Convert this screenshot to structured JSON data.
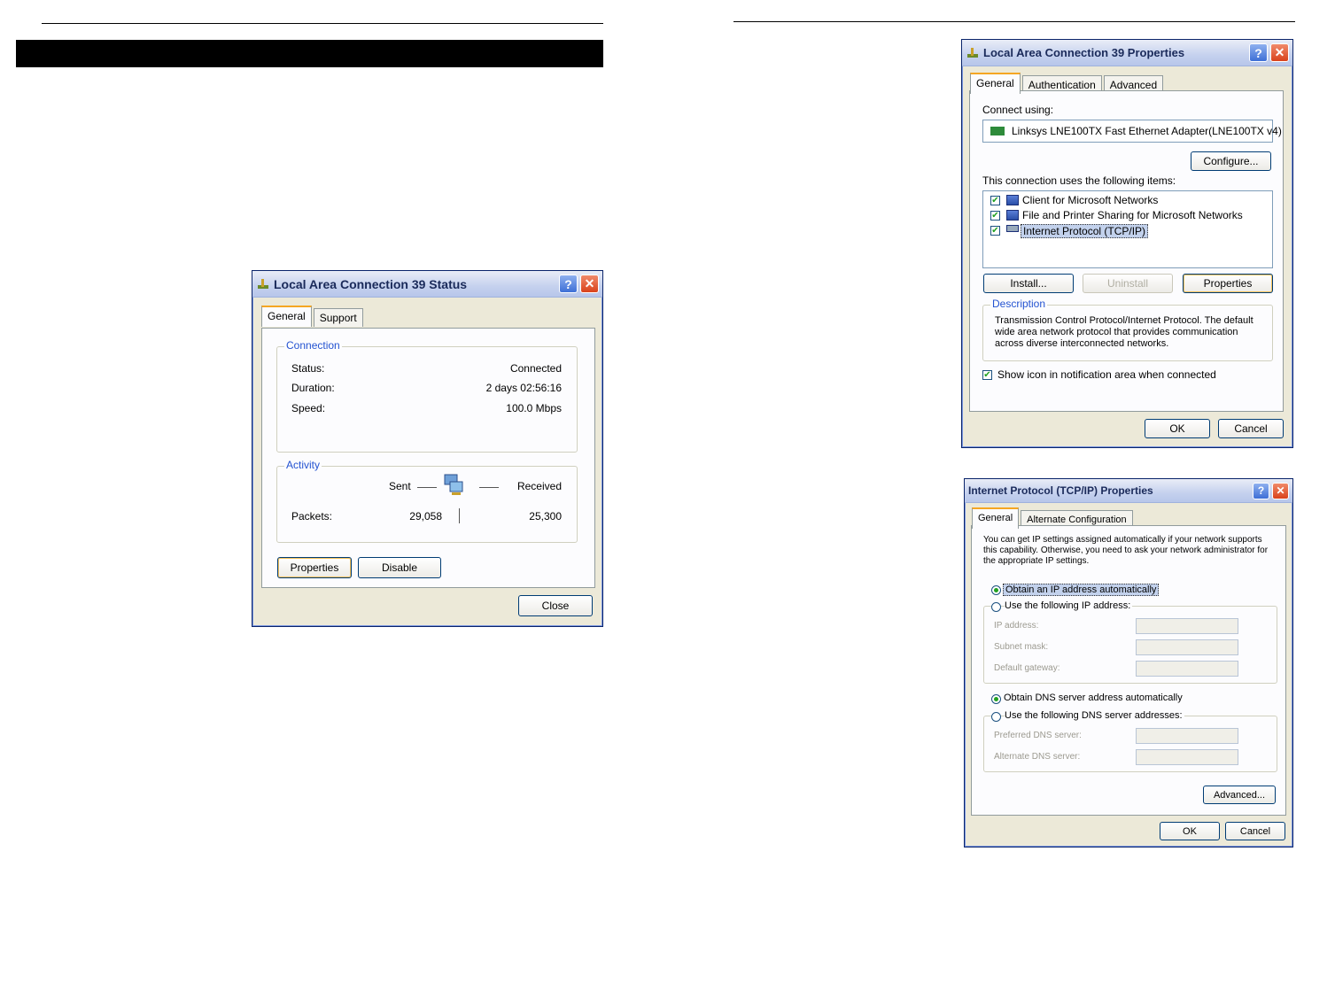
{
  "status_dialog": {
    "title": "Local Area Connection 39 Status",
    "tabs": [
      "General",
      "Support"
    ],
    "connection": {
      "legend": "Connection",
      "rows": [
        {
          "label": "Status:",
          "value": "Connected"
        },
        {
          "label": "Duration:",
          "value": "2 days 02:56:16"
        },
        {
          "label": "Speed:",
          "value": "100.0 Mbps"
        }
      ]
    },
    "activity": {
      "legend": "Activity",
      "sent": "Sent",
      "received": "Received",
      "packets_label": "Packets:",
      "packets_sent": "29,058",
      "packets_received": "25,300"
    },
    "buttons": {
      "properties": "Properties",
      "disable": "Disable",
      "close": "Close"
    }
  },
  "props_dialog": {
    "title": "Local Area Connection 39 Properties",
    "tabs": [
      "General",
      "Authentication",
      "Advanced"
    ],
    "connect_using_label": "Connect using:",
    "adapter": "Linksys LNE100TX Fast Ethernet Adapter(LNE100TX v4)",
    "configure": "Configure...",
    "items_label": "This connection uses the following items:",
    "items": [
      {
        "label": "Client for Microsoft Networks",
        "checked": true
      },
      {
        "label": "File and Printer Sharing for Microsoft Networks",
        "checked": true
      },
      {
        "label": "Internet Protocol (TCP/IP)",
        "checked": true
      }
    ],
    "buttons": {
      "install": "Install...",
      "uninstall": "Uninstall",
      "properties": "Properties",
      "ok": "OK",
      "cancel": "Cancel"
    },
    "description_legend": "Description",
    "description_lines": [
      "Transmission Control Protocol/Internet Protocol. The default",
      "wide area network protocol that provides communication",
      "across diverse interconnected networks."
    ],
    "show_icon_label": "Show icon in notification area when connected"
  },
  "tcpip_dialog": {
    "title": "Internet Protocol (TCP/IP) Properties",
    "tabs": [
      "General",
      "Alternate Configuration"
    ],
    "intro_lines": [
      "You can get IP settings assigned automatically if your network supports",
      "this capability. Otherwise, you need to ask your network administrator for",
      "the appropriate IP settings."
    ],
    "obtain_ip": "Obtain an IP address automatically",
    "use_ip": "Use the following IP address:",
    "ip_fields": [
      "IP address:",
      "Subnet mask:",
      "Default gateway:"
    ],
    "obtain_dns": "Obtain DNS server address automatically",
    "use_dns": "Use the following DNS server addresses:",
    "dns_fields": [
      "Preferred DNS server:",
      "Alternate DNS server:"
    ],
    "buttons": {
      "advanced": "Advanced...",
      "ok": "OK",
      "cancel": "Cancel"
    }
  }
}
